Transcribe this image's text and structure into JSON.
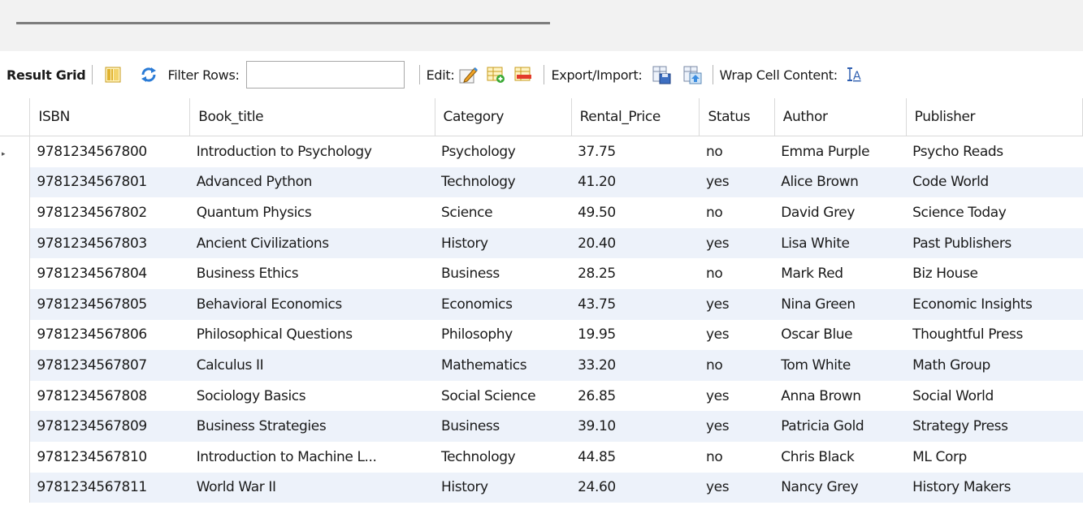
{
  "toolbar": {
    "result_grid_label": "Result Grid",
    "filter_rows_label": "Filter Rows:",
    "filter_rows_value": "",
    "edit_label": "Edit:",
    "export_import_label": "Export/Import:",
    "wrap_cell_content_label": "Wrap Cell Content:",
    "icons": [
      "form-view-icon",
      "refresh-icon",
      "edit-row-icon",
      "insert-row-icon",
      "delete-row-icon",
      "export-icon",
      "import-icon",
      "wrap-text-icon"
    ]
  },
  "grid": {
    "columns": [
      "ISBN",
      "Book_title",
      "Category",
      "Rental_Price",
      "Status",
      "Author",
      "Publisher"
    ],
    "rows": [
      [
        "9781234567800",
        "Introduction to Psychology",
        "Psychology",
        "37.75",
        "no",
        "Emma Purple",
        "Psycho Reads"
      ],
      [
        "9781234567801",
        "Advanced Python",
        "Technology",
        "41.20",
        "yes",
        "Alice Brown",
        "Code World"
      ],
      [
        "9781234567802",
        "Quantum Physics",
        "Science",
        "49.50",
        "no",
        "David Grey",
        "Science Today"
      ],
      [
        "9781234567803",
        "Ancient Civilizations",
        "History",
        "20.40",
        "yes",
        "Lisa White",
        "Past Publishers"
      ],
      [
        "9781234567804",
        "Business Ethics",
        "Business",
        "28.25",
        "no",
        "Mark Red",
        "Biz House"
      ],
      [
        "9781234567805",
        "Behavioral Economics",
        "Economics",
        "43.75",
        "yes",
        "Nina Green",
        "Economic Insights"
      ],
      [
        "9781234567806",
        "Philosophical Questions",
        "Philosophy",
        "19.95",
        "yes",
        "Oscar Blue",
        "Thoughtful Press"
      ],
      [
        "9781234567807",
        "Calculus II",
        "Mathematics",
        "33.20",
        "no",
        "Tom White",
        "Math Group"
      ],
      [
        "9781234567808",
        "Sociology Basics",
        "Social Science",
        "26.85",
        "yes",
        "Anna Brown",
        "Social World"
      ],
      [
        "9781234567809",
        "Business Strategies",
        "Business",
        "39.10",
        "yes",
        "Patricia Gold",
        "Strategy Press"
      ],
      [
        "9781234567810",
        "Introduction to Machine L...",
        "Technology",
        "44.85",
        "no",
        "Chris Black",
        "ML Corp"
      ],
      [
        "9781234567811",
        "World War II",
        "History",
        "24.60",
        "yes",
        "Nancy Grey",
        "History Makers"
      ]
    ]
  },
  "colors": {
    "alt_row": "#edf2fa",
    "border": "#d9d9d9"
  }
}
